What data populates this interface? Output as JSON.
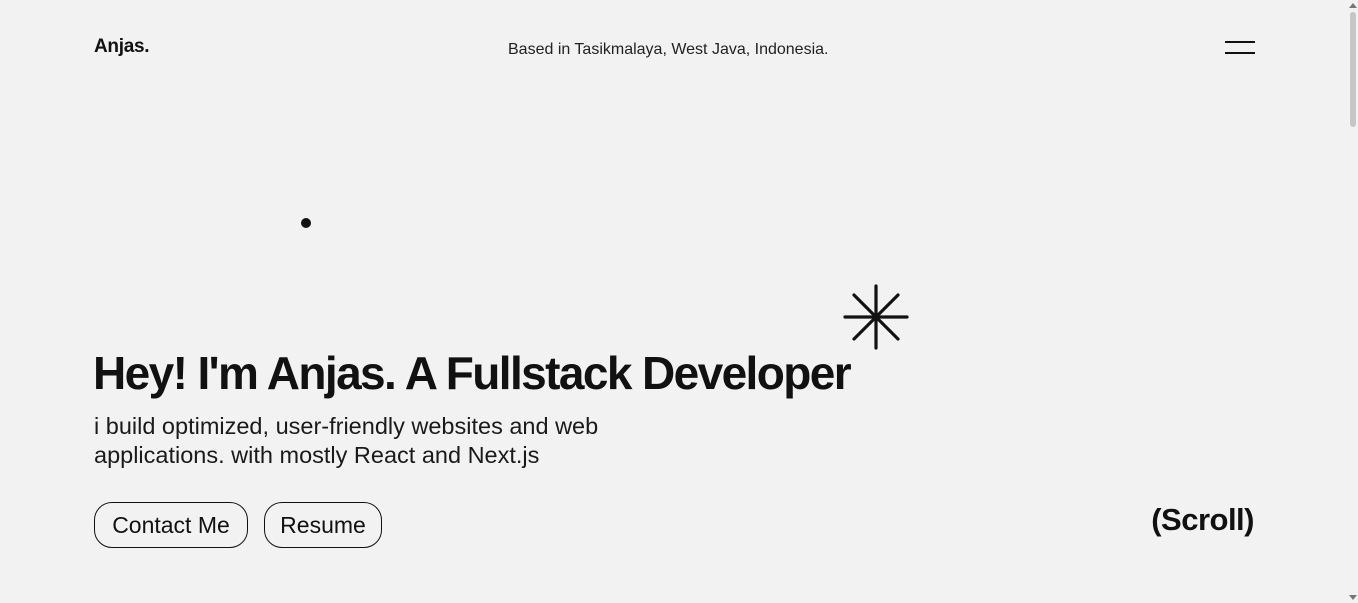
{
  "header": {
    "logo": "Anjas.",
    "location": "Based in Tasikmalaya, West Java, Indonesia.",
    "menu_icon": "hamburger-menu-icon"
  },
  "hero": {
    "decor_icon": "asterisk-icon",
    "headline": "Hey! I'm Anjas. A Fullstack Developer",
    "subline": "i build optimized, user-friendly websites and web applications. with mostly React and Next.js",
    "buttons": {
      "contact_label": "Contact Me",
      "resume_label": "Resume"
    },
    "scroll_label": "(Scroll)"
  },
  "colors": {
    "background": "#f2f2f2",
    "text": "#111111"
  }
}
